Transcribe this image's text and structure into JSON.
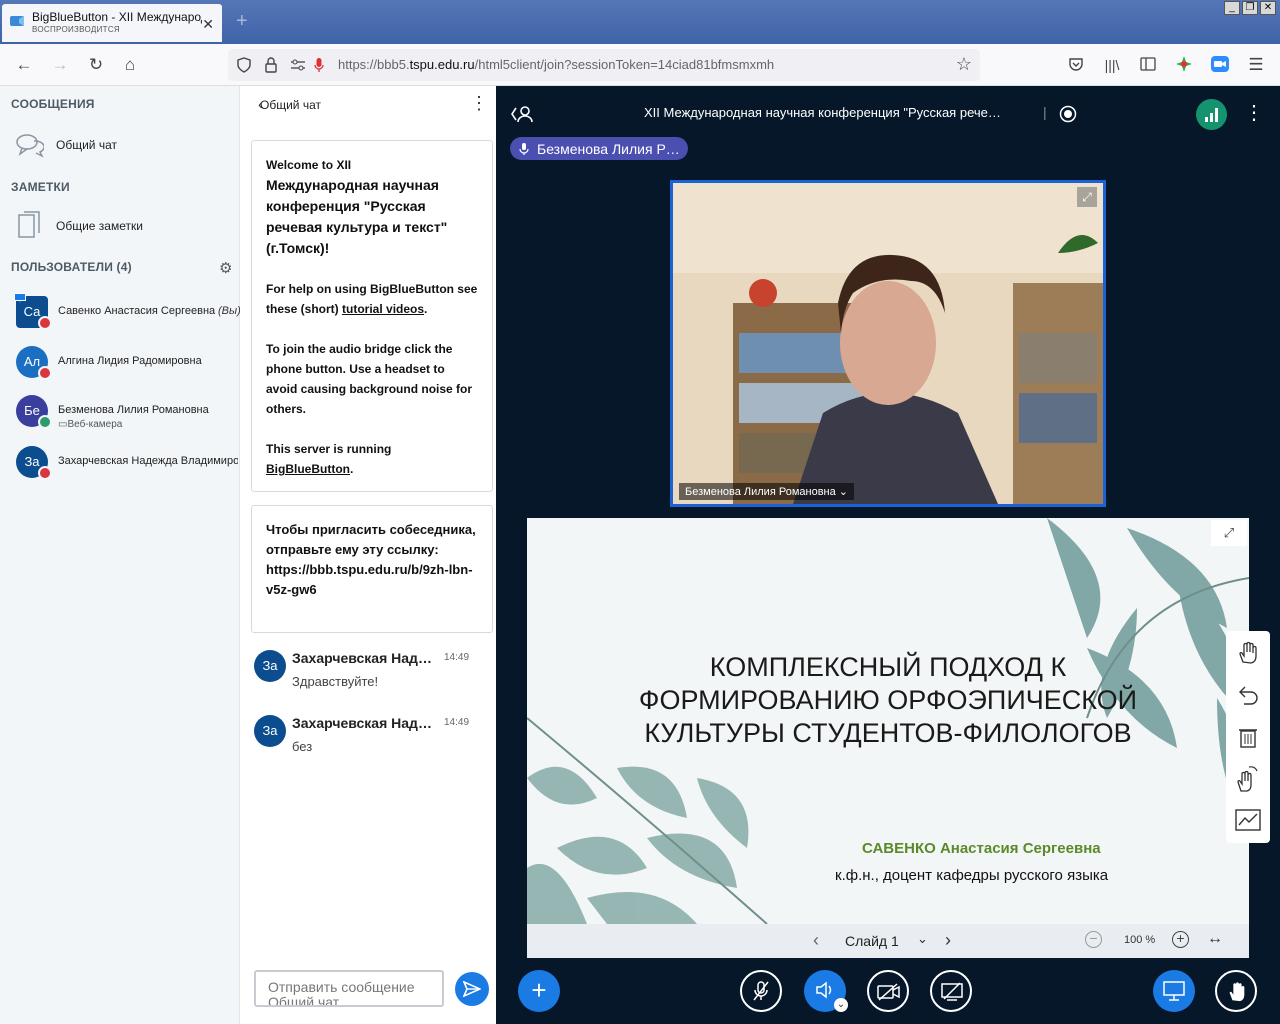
{
  "browser": {
    "tab_title": "BigBlueButton - XII Международная",
    "tab_subtitle": "ВОСПРОИЗВОДИТСЯ",
    "url_prefix": "https://bbb5.",
    "url_domain": "tspu.edu.ru",
    "url_rest": "/html5client/join?sessionToken=14ciad81bfmsmxmh"
  },
  "sidebar": {
    "messages_heading": "СООБЩЕНИЯ",
    "public_chat": "Общий чат",
    "notes_heading": "ЗАМЕТКИ",
    "shared_notes": "Общие заметки",
    "users_heading": "ПОЛЬЗОВАТЕЛИ (4)",
    "users": [
      {
        "initials": "Са",
        "name": "Савенко Анастасия Сергеевна",
        "you": "(Вы)",
        "color": "#0b4d8e",
        "status": "muted"
      },
      {
        "initials": "Ал",
        "name": "Алгина Лидия Радомировна",
        "color": "#1b6fc2",
        "status": "muted"
      },
      {
        "initials": "Бе",
        "name": "Безменова Лилия Романовна",
        "sub": "Веб-камера",
        "color": "#3a3f9e",
        "status": "talking"
      },
      {
        "initials": "За",
        "name": "Захарчевская Надежда Владимировна",
        "color": "#0b4d8e",
        "status": "muted"
      }
    ]
  },
  "chat": {
    "title": "Общий чат",
    "welcome_l1": "Welcome to XII",
    "welcome_l2": "Международная научная конференция \"Русская речевая культура и текст\" (г.Томск)!",
    "welcome_help_a": "For help on using BigBlueButton see these (short) ",
    "welcome_help_link": "tutorial videos",
    "welcome_audio": "To join the audio bridge click the phone button. Use a headset to avoid causing background noise for others.",
    "welcome_server_a": "This server is running ",
    "welcome_server_link": "BigBlueButton",
    "invite": "Чтобы пригласить собеседника, отправьте ему эту ссылку: https://bbb.tspu.edu.ru/b/9zh-lbn-v5z-gw6",
    "messages": [
      {
        "initials": "За",
        "sender": "Захарчевская Надежда Владимировна",
        "time": "14:49",
        "text": "Здравствуйте!"
      },
      {
        "initials": "За",
        "sender": "Захарчевская Надежда Владимировна",
        "time": "14:49",
        "text": "без"
      }
    ],
    "input_placeholder": "Отправить сообщение Общий чат"
  },
  "meeting": {
    "title": "XII Международная научная конференция \"Русская рече…",
    "talking": "Безменова Лилия Р…",
    "webcam_label": "Безменова Лилия Романовна",
    "slide": {
      "title_l1": "КОМПЛЕКСНЫЙ ПОДХОД К",
      "title_l2": "ФОРМИРОВАНИЮ ОРФОЭПИЧЕСКОЙ",
      "title_l3": "КУЛЬТУРЫ СТУДЕНТОВ-ФИЛОЛОГОВ",
      "author": "САВЕНКО Анастасия Сергеевна",
      "degree": "к.ф.н., доцент кафедры русского языка"
    },
    "slide_label": "Слайд 1",
    "zoom": "100 %"
  },
  "colors": {
    "accent": "#1b7be4",
    "main_bg": "#06172a",
    "muted": "#d9363e",
    "talking": "#2a9d6a"
  }
}
